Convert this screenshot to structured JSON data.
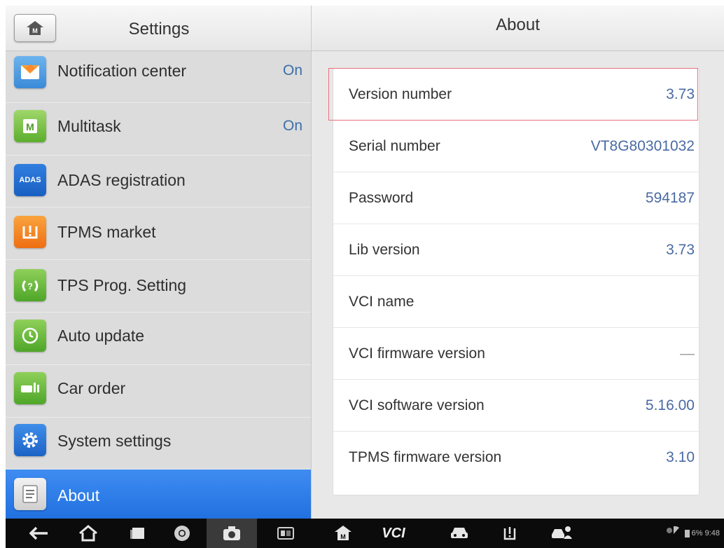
{
  "left_panel": {
    "title": "Settings",
    "items": [
      {
        "label": "Notification center",
        "state": "On",
        "icon": "notification-icon"
      },
      {
        "label": "Multitask",
        "state": "On",
        "icon": "multitask-icon"
      },
      {
        "label": "ADAS registration",
        "state": "",
        "icon": "adas-icon",
        "icon_text": "ADAS"
      },
      {
        "label": "TPMS market",
        "state": "",
        "icon": "tpms-icon"
      },
      {
        "label": "TPS Prog. Setting",
        "state": "",
        "icon": "tps-prog-icon"
      },
      {
        "label": "Auto update",
        "state": "",
        "icon": "auto-update-icon"
      },
      {
        "label": "Car order",
        "state": "",
        "icon": "car-order-icon"
      },
      {
        "label": "System settings",
        "state": "",
        "icon": "gear-icon"
      },
      {
        "label": "About",
        "state": "",
        "icon": "about-icon",
        "active": true
      }
    ]
  },
  "right_panel": {
    "title": "About",
    "rows": [
      {
        "key": "Version number",
        "value": "3.73"
      },
      {
        "key": "Serial number",
        "value": "VT8G80301032"
      },
      {
        "key": "Password",
        "value": "594187"
      },
      {
        "key": "Lib version",
        "value": "3.73"
      },
      {
        "key": "VCI name",
        "value": ""
      },
      {
        "key": "VCI firmware version",
        "value": "—"
      },
      {
        "key": "VCI software version",
        "value": "5.16.00"
      },
      {
        "key": "TPMS firmware version",
        "value": "3.10"
      }
    ]
  },
  "navbar": {
    "vci_label": "VCI",
    "status_text": "6% 9:48",
    "icons": [
      "back-icon",
      "home-icon",
      "recent-apps-icon",
      "browser-icon",
      "camera-icon",
      "display-icon",
      "autel-home-icon",
      "vci-icon",
      "car-icon",
      "tpms-icon",
      "vehicle-manage-icon",
      "wifi-icon",
      "battery-icon"
    ]
  },
  "colors": {
    "accent_blue": "#2a78e6",
    "value_blue": "#4a6aa3",
    "highlight_red": "#e8707e"
  }
}
